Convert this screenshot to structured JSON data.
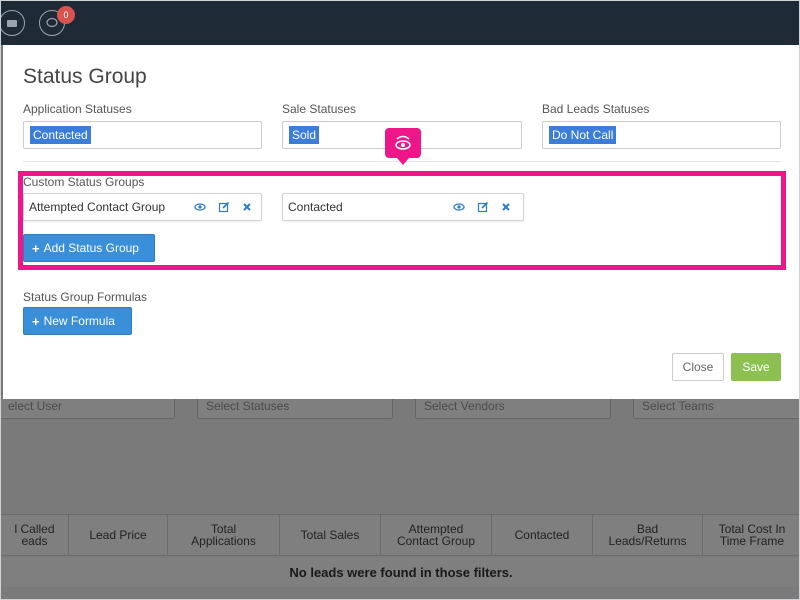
{
  "topbar": {
    "badge_count": "0"
  },
  "modal": {
    "title": "Status Group",
    "application_statuses": {
      "label": "Application Statuses",
      "tag": "Contacted"
    },
    "sale_statuses": {
      "label": "Sale Statuses",
      "tag": "Sold"
    },
    "bad_leads_statuses": {
      "label": "Bad Leads Statuses",
      "tag": "Do Not Call"
    },
    "custom_groups": {
      "label": "Custom Status Groups",
      "items": [
        {
          "name": "Attempted Contact Group"
        },
        {
          "name": "Contacted"
        }
      ],
      "add_label": "Add Status Group"
    },
    "formulas": {
      "label": "Status Group Formulas",
      "new_label": "New Formula"
    },
    "close_label": "Close",
    "save_label": "Save"
  },
  "background": {
    "filters": [
      "elect User",
      "Select Statuses",
      "Select Vendors",
      "Select Teams"
    ],
    "columns": [
      [
        "l Called",
        "eads"
      ],
      [
        "Lead Price"
      ],
      [
        "Total",
        "Applications"
      ],
      [
        "Total Sales"
      ],
      [
        "Attempted",
        "Contact Group"
      ],
      [
        "Contacted"
      ],
      [
        "Bad",
        "Leads/Returns"
      ],
      [
        "Total Cost In",
        "Time Frame"
      ]
    ],
    "empty_message": "No leads were found in those filters."
  },
  "colors": {
    "highlight": "#ee1689",
    "primary": "#3a8fd9",
    "save": "#8cc152",
    "tag": "#3b7dd8"
  }
}
